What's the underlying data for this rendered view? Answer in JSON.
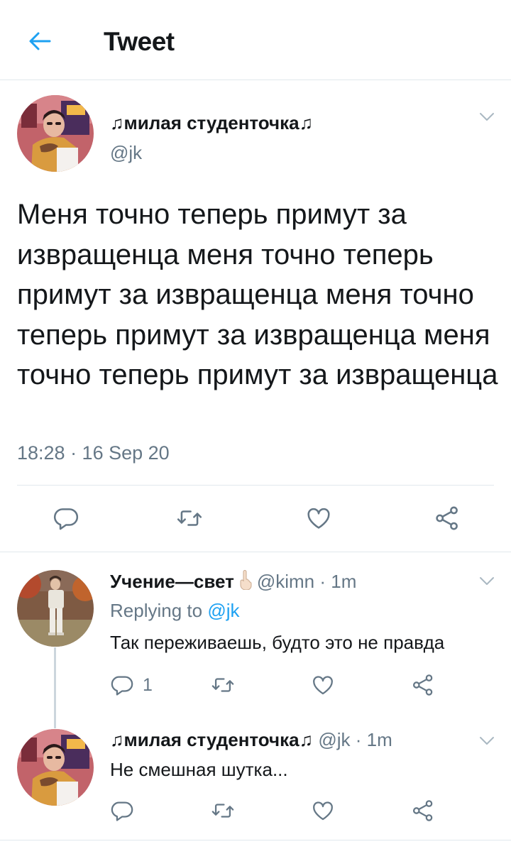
{
  "header": {
    "title": "Tweet",
    "back_icon": "arrow-left-icon"
  },
  "colors": {
    "accent": "#1da1f2",
    "muted": "#657786",
    "divider": "#e1e8ed"
  },
  "main_tweet": {
    "display_name": "♫милая студенточка♫",
    "handle": "@jk",
    "text": "Меня точно теперь примут за извращенца меня точно теперь примут за извращенца меня точно теперь примут за извращенца меня точно теперь примут за извращенца",
    "timestamp": "18:28 · 16 Sep 20",
    "actions": [
      "reply-icon",
      "retweet-icon",
      "like-icon",
      "share-icon"
    ]
  },
  "replies": [
    {
      "display_name": "Учение—свет",
      "emoji": "☝",
      "handle": "@kimn",
      "time": "· 1m",
      "replying_label": "Replying to",
      "replying_to": "@jk",
      "text": "Так переживаешь, будто это не правда",
      "reply_count": "1"
    },
    {
      "display_name": "♫милая студенточка♫",
      "handle": "@jk",
      "time": "· 1m",
      "text": "Не смешная шутка..."
    }
  ]
}
